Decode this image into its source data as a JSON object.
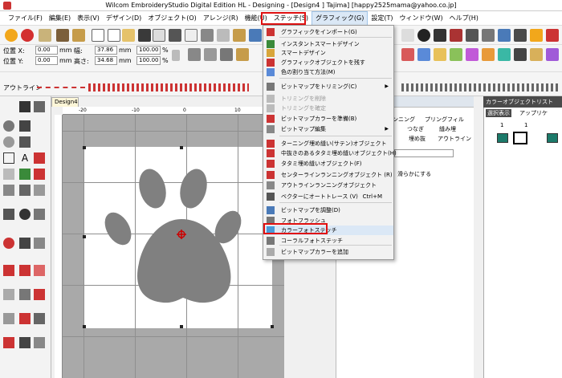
{
  "window": {
    "title": "Wilcom EmbroideryStudio Digital Edition HL - Designing - [Design4    ]  Tajima]  [happy2525mama@yahoo.co.jp]"
  },
  "menubar": {
    "items": [
      "ファイル(F)",
      "編集(E)",
      "表示(V)",
      "デザイン(D)",
      "オブジェクト(O)",
      "アレンジ(R)",
      "機能(U)",
      "ステッチ(S)",
      "グラフィック(G)",
      "設定(T)",
      "ウィンドウ(W)",
      "ヘルプ(H)"
    ]
  },
  "fields": {
    "pos_x_label": "位置 X:",
    "pos_y_label": "位置 Y:",
    "pos_x": "0.00",
    "pos_y": "0.00",
    "unit": "mm",
    "width_label": "幅:",
    "height_label": "高さ:",
    "width": "37.86",
    "height": "34.68",
    "scale_w": "100.00",
    "scale_h": "100.00",
    "pct": "%"
  },
  "outline_label": "アウトライン",
  "doc_tab": "Design4",
  "ruler": {
    "ticks": [
      "-20",
      "-10",
      "0",
      "10"
    ]
  },
  "right_panel": {
    "ranning": "ンニング",
    "fill": "プリングフィル",
    "tsunagi": "つなぎ",
    "tatami": "縫み埋",
    "umenuki": "埋め抜",
    "outline": "アウトライン",
    "smooth_text": "滑らかにする"
  },
  "object_list": {
    "title": "カラーオブジェクトリスト",
    "tab_selected": "選択表示",
    "tab_applique": "アップリケ",
    "n1": "1",
    "n2": "1"
  },
  "graphics_menu": {
    "items": [
      {
        "label": "グラフィックをインポート(G)",
        "disabled": false
      },
      {
        "label": "インスタントスマートデザイン",
        "disabled": false
      },
      {
        "label": "スマートデザイン",
        "disabled": false
      },
      {
        "label": "グラフィックオブジェクトを残す",
        "disabled": false
      },
      {
        "label": "色の割り当て方法(M)",
        "disabled": false
      },
      {
        "label": "ビットマップをトリミング(C)",
        "disabled": false,
        "submenu": true
      },
      {
        "label": "トリミングを削除",
        "disabled": true
      },
      {
        "label": "トリミングを確定",
        "disabled": true
      },
      {
        "label": "ビットマップカラーを準備(B)",
        "disabled": false
      },
      {
        "label": "ビットマップ編集",
        "disabled": false,
        "submenu": true
      },
      {
        "label": "ターニング埋め縫い(サテン)オブジェクト",
        "disabled": false
      },
      {
        "label": "中抜きのあるタタミ埋め縫いオブジェクト(H)",
        "disabled": false
      },
      {
        "label": "タタミ埋め縫いオブジェクト(F)",
        "disabled": false
      },
      {
        "label": "センターラインランニングオブジェクト  (R)",
        "disabled": false
      },
      {
        "label": "アウトラインランニングオブジェクト",
        "disabled": false
      },
      {
        "label": "ベクターにオートトレース  (V)",
        "disabled": false,
        "shortcut": "Ctrl+M"
      },
      {
        "label": "ビットマップを調整(D)",
        "disabled": false
      },
      {
        "label": "フォトフラッシュ",
        "disabled": false
      },
      {
        "label": "カラーフォトステッチ",
        "disabled": false
      },
      {
        "label": "コーラルフォトステッチ",
        "disabled": false
      },
      {
        "label": "ビットマップカラーを追加",
        "disabled": false
      }
    ]
  },
  "colors": {
    "highlight_red": "#e01010",
    "paw_gray": "#808080",
    "canvas_gray": "#a9a9a9"
  }
}
